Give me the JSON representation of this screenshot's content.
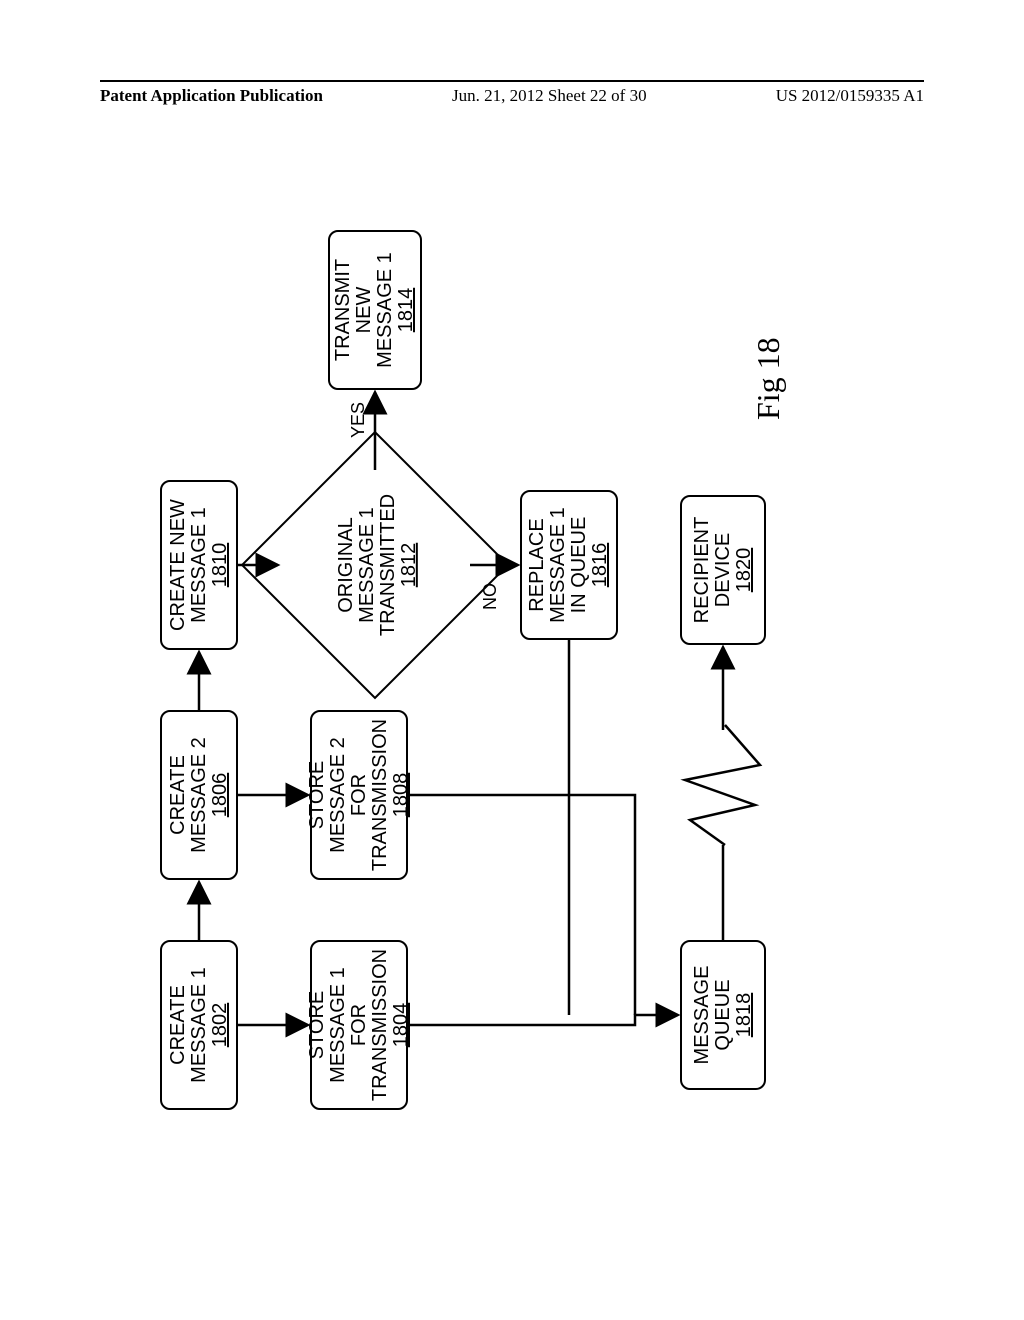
{
  "header": {
    "left": "Patent Application Publication",
    "mid": "Jun. 21, 2012  Sheet 22 of 30",
    "right": "US 2012/0159335 A1"
  },
  "fig": {
    "caption": "Fig 18"
  },
  "labels": {
    "yes": "YES",
    "no": "NO"
  },
  "nodes": {
    "n1802": {
      "line1": "CREATE",
      "line2": "MESSAGE 1",
      "ref": "1802"
    },
    "n1804": {
      "line1": "STORE",
      "line2": "MESSAGE 1 FOR",
      "line3": "TRANSMISSION",
      "ref": "1804"
    },
    "n1806": {
      "line1": "CREATE",
      "line2": "MESSAGE 2",
      "ref": "1806"
    },
    "n1808": {
      "line1": "STORE",
      "line2": "MESSAGE 2 FOR",
      "line3": "TRANSMISSION",
      "ref": "1808"
    },
    "n1810": {
      "line1": "CREATE NEW",
      "line2": "MESSAGE 1",
      "ref": "1810"
    },
    "n1812": {
      "line1": "ORIGINAL",
      "line2": "MESSAGE 1",
      "line3": "TRANSMITTED",
      "ref": "1812"
    },
    "n1814": {
      "line1": "TRANSMIT NEW",
      "line2": "MESSAGE 1",
      "ref": "1814"
    },
    "n1816": {
      "line1": "REPLACE",
      "line2": "MESSAGE 1",
      "line3": "IN QUEUE",
      "ref": "1816"
    },
    "n1818": {
      "line1": "MESSAGE",
      "line2": "QUEUE",
      "ref": "1818"
    },
    "n1820": {
      "line1": "RECIPIENT",
      "line2": "DEVICE",
      "ref": "1820"
    }
  }
}
